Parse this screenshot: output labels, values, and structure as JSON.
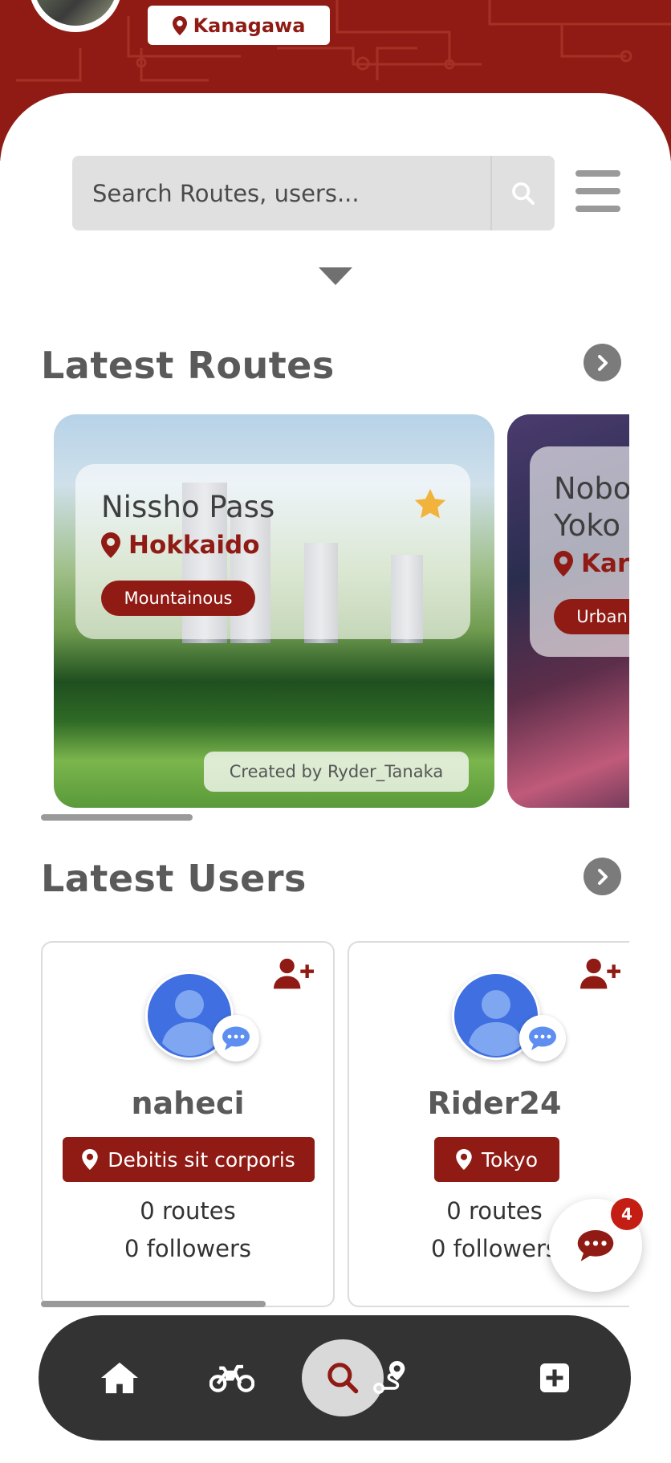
{
  "header": {
    "location": "Kanagawa"
  },
  "search": {
    "placeholder": "Search Routes, users..."
  },
  "latest_routes": {
    "title": "Latest Routes",
    "routes": [
      {
        "name": "Nissho Pass",
        "location": "Hokkaido",
        "tag": "Mountainous",
        "creator": "Created by Ryder_Tanaka",
        "favorite": true
      },
      {
        "name_line1": "Nobo",
        "name_line2": "Yoko",
        "location": "Kar",
        "tag": "Urban"
      }
    ]
  },
  "latest_users": {
    "title": "Latest Users",
    "users": [
      {
        "name": "naheci",
        "location": "Debitis sit corporis",
        "routes": "0 routes",
        "followers": "0 followers"
      },
      {
        "name": "Rider24",
        "location": "Tokyo",
        "routes": "0 routes",
        "followers": "0 followers"
      }
    ]
  },
  "chat": {
    "badge": "4"
  },
  "colors": {
    "brand": "#8f1b14",
    "nav_bg": "#333333",
    "star": "#f2b33d",
    "avatar_blue": "#3f6fe0"
  },
  "nav": {
    "items": [
      "home-icon",
      "motorcycle-icon",
      "search-icon",
      "route-icon",
      "add-icon"
    ],
    "active": "search-icon"
  }
}
